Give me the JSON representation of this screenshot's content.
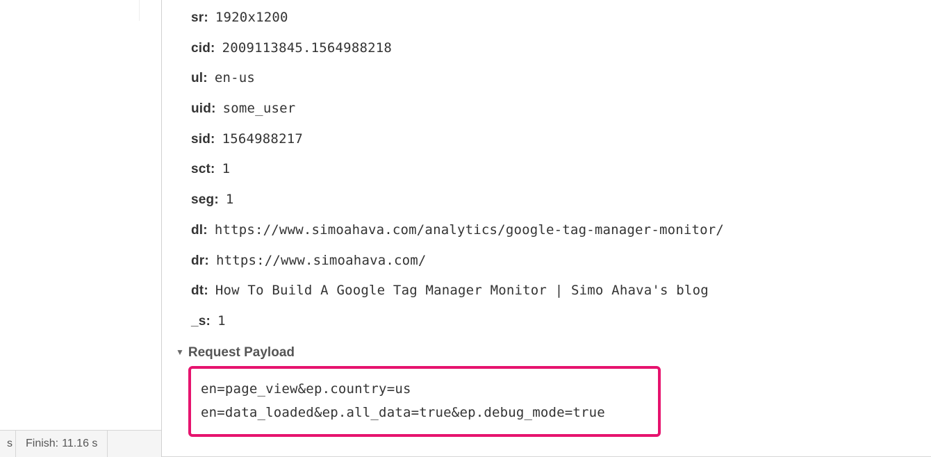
{
  "status": {
    "left_truncated": "s",
    "finish_label": "Finish:",
    "finish_value": "11.16 s"
  },
  "params": [
    {
      "key": "sr:",
      "value": "1920x1200"
    },
    {
      "key": "cid:",
      "value": "2009113845.1564988218"
    },
    {
      "key": "ul:",
      "value": "en-us"
    },
    {
      "key": "uid:",
      "value": "some_user"
    },
    {
      "key": "sid:",
      "value": "1564988217"
    },
    {
      "key": "sct:",
      "value": "1"
    },
    {
      "key": "seg:",
      "value": "1"
    },
    {
      "key": "dl:",
      "value": "https://www.simoahava.com/analytics/google-tag-manager-monitor/"
    },
    {
      "key": "dr:",
      "value": "https://www.simoahava.com/"
    },
    {
      "key": "dt:",
      "value": "How To Build A Google Tag Manager Monitor | Simo Ahava's blog"
    },
    {
      "key": "_s:",
      "value": "1"
    }
  ],
  "payload": {
    "header": "Request Payload",
    "lines": [
      "en=page_view&ep.country=us",
      "en=data_loaded&ep.all_data=true&ep.debug_mode=true"
    ]
  },
  "colors": {
    "highlight_border": "#e6136e"
  }
}
